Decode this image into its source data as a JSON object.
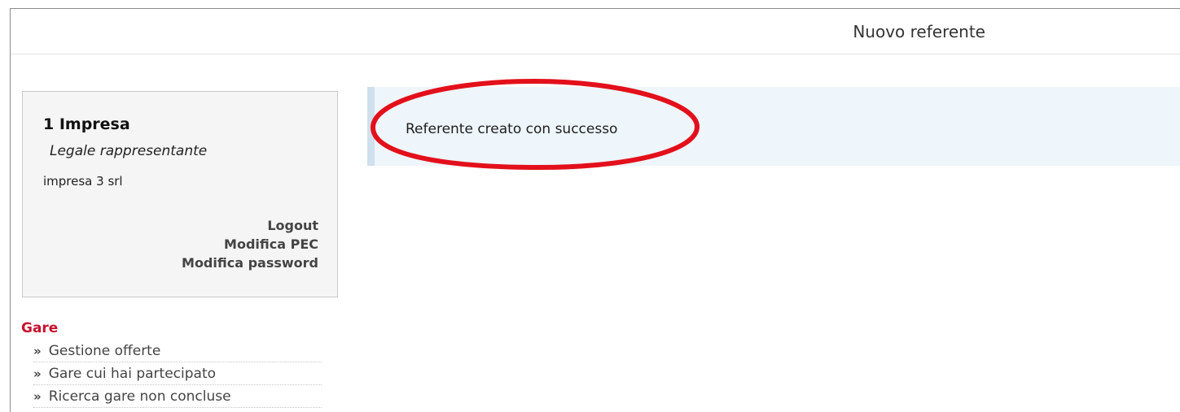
{
  "header": {
    "title": "Nuovo referente"
  },
  "user_panel": {
    "company": "1 Impresa",
    "role": "Legale rappresentante",
    "company_detail": "impresa 3 srl",
    "links": {
      "logout": "Logout",
      "edit_pec": "Modifica PEC",
      "edit_password": "Modifica password"
    }
  },
  "nav": {
    "section_title": "Gare",
    "items": [
      {
        "label": "Gestione offerte",
        "icon": "double-chevron-right-icon"
      },
      {
        "label": "Gare cui hai partecipato",
        "icon": "double-chevron-right-icon"
      },
      {
        "label": "Ricerca gare non concluse",
        "icon": "double-chevron-right-icon"
      }
    ],
    "chevron_glyph": "»"
  },
  "message": {
    "text": "Referente creato con successo"
  },
  "colors": {
    "nav_title": "#c8102e",
    "annotation_ellipse": "#e3101b",
    "message_background": "#eef5fb",
    "message_border": "#cfe0ee",
    "user_box_background": "#f5f5f5"
  }
}
